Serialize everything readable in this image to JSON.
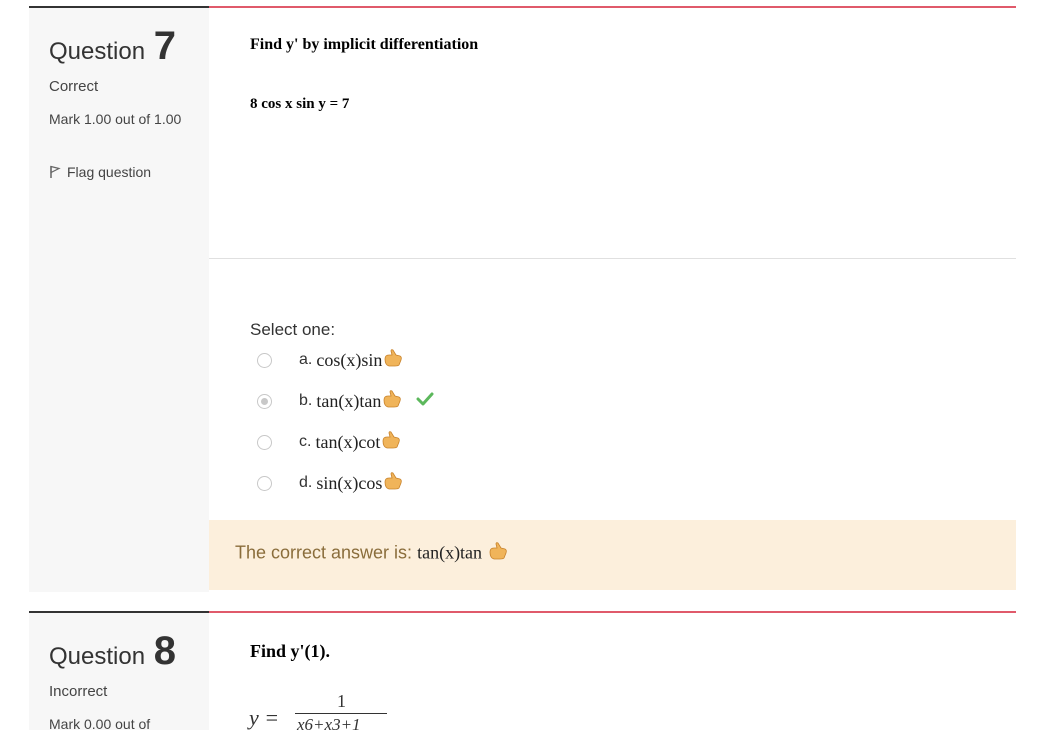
{
  "questions": [
    {
      "label": "Question",
      "number": "7",
      "state": "Correct",
      "grade": "Mark 1.00 out of 1.00",
      "flag": "Flag question",
      "prompt": "Find y' by implicit differentiation",
      "equation": "8 cos x sin y = 7",
      "select_label": "Select one:",
      "options": [
        {
          "letter": "a.",
          "math": "cos(x)sin",
          "checked": false
        },
        {
          "letter": "b.",
          "math": "tan(x)tan",
          "checked": true,
          "correct": true
        },
        {
          "letter": "c.",
          "math": "tan(x)cot",
          "checked": false
        },
        {
          "letter": "d.",
          "math": "sin(x)cos",
          "checked": false
        }
      ],
      "feedback_label": "The correct answer is:",
      "feedback_math": "tan(x)tan"
    },
    {
      "label": "Question",
      "number": "8",
      "state": "Incorrect",
      "grade": "Mark 0.00 out of",
      "prompt": "Find y'(1).",
      "formula": {
        "lhs": "y =",
        "numerator": "1",
        "denominator": "x6+x3+1"
      }
    }
  ],
  "colors": {
    "accent_border": "#e05a6b",
    "info_border": "#333333",
    "feedback_bg": "#fcefdc",
    "feedback_text": "#8a6d3b",
    "check": "#5cb85c"
  },
  "icons": {
    "thumb": "thumbs-emoji-icon",
    "flag": "flag-icon",
    "check": "check-icon"
  }
}
